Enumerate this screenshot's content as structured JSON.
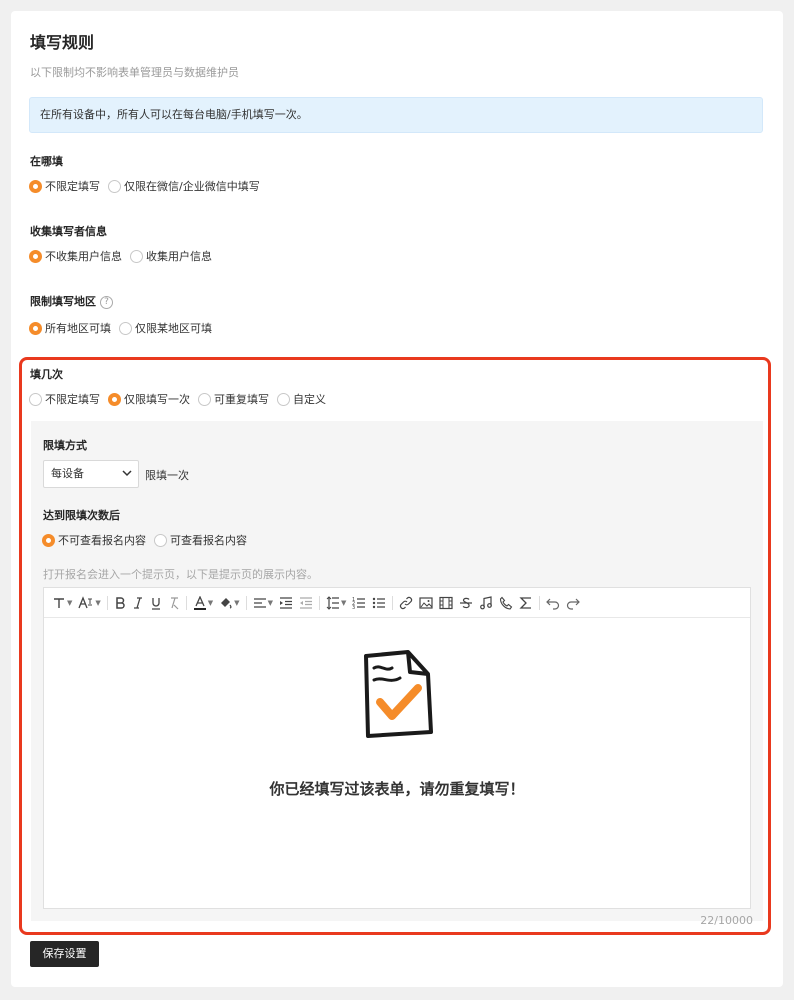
{
  "page": {
    "title": "填写规则",
    "subtitle": "以下限制均不影响表单管理员与数据维护员",
    "notice": "在所有设备中，所有人可以在每台电脑/手机填写一次。"
  },
  "where_fill": {
    "label": "在哪填",
    "options": [
      "不限定填写",
      "仅限在微信/企业微信中填写"
    ],
    "selected": 0
  },
  "collect_info": {
    "label": "收集填写者信息",
    "options": [
      "不收集用户信息",
      "收集用户信息"
    ],
    "selected": 0
  },
  "region_limit": {
    "label": "限制填写地区",
    "help_icon": "question-circle-icon",
    "options": [
      "所有地区可填",
      "仅限某地区可填"
    ],
    "selected": 0
  },
  "fill_times": {
    "label": "填几次",
    "options": [
      "不限定填写",
      "仅限填写一次",
      "可重复填写",
      "自定义"
    ],
    "selected": 1
  },
  "limit_method": {
    "label": "限填方式",
    "select_value": "每设备",
    "suffix": "限填一次"
  },
  "after_limit": {
    "label": "达到限填次数后",
    "options": [
      "不可查看报名内容",
      "可查看报名内容"
    ],
    "selected": 0,
    "hint": "打开报名会进入一个提示页，以下是提示页的展示内容。"
  },
  "editor": {
    "message": "你已经填写过该表单，请勿重复填写！",
    "counter": "22/10000",
    "toolbar_icons": [
      "font-size-icon",
      "font-style-icon",
      "bold-icon",
      "italic-icon",
      "underline-icon",
      "clear-format-icon",
      "font-color-icon",
      "highlight-icon",
      "align-icon",
      "indent-icon",
      "outdent-icon",
      "line-height-icon",
      "ordered-list-icon",
      "unordered-list-icon",
      "link-icon",
      "image-icon",
      "video-icon",
      "strikethrough-icon",
      "audio-icon",
      "phone-icon",
      "formula-icon",
      "undo-icon",
      "redo-icon"
    ]
  },
  "actions": {
    "save": "保存设置"
  },
  "colors": {
    "accent": "#f58c2a",
    "highlight_border": "#e9391e",
    "notice_bg": "#e3f2fd",
    "button_bg": "#262626"
  }
}
